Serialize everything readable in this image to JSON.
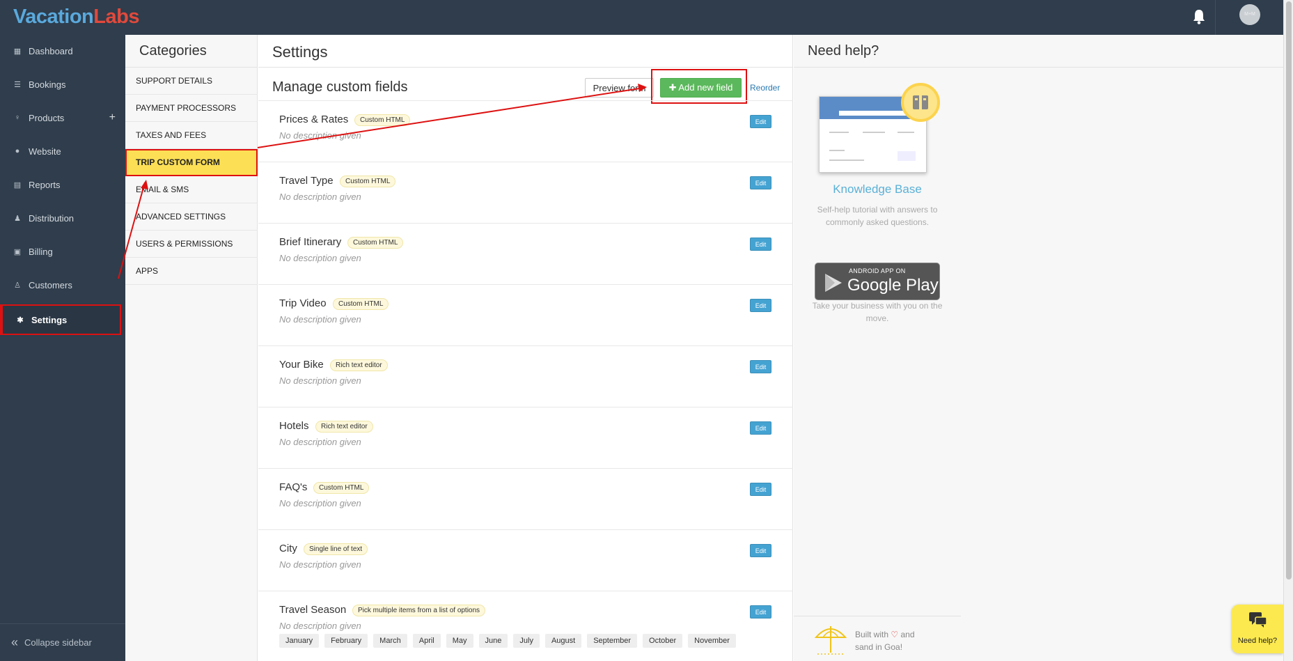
{
  "app": {
    "logo_part1": "Vacation",
    "logo_part2": "Labs",
    "avatar_text": "M+M"
  },
  "sidebar": {
    "items": [
      {
        "label": "Dashboard",
        "icon": "calendar-icon"
      },
      {
        "label": "Bookings",
        "icon": "list-icon"
      },
      {
        "label": "Products",
        "icon": "pin-icon",
        "action": "+"
      },
      {
        "label": "Website",
        "icon": "globe-icon"
      },
      {
        "label": "Reports",
        "icon": "report-icon"
      },
      {
        "label": "Distribution",
        "icon": "users-icon"
      },
      {
        "label": "Billing",
        "icon": "money-icon"
      },
      {
        "label": "Customers",
        "icon": "user-icon"
      },
      {
        "label": "Settings",
        "icon": "gear-icon",
        "active": true
      }
    ],
    "collapse_label": "Collapse sidebar"
  },
  "categories": {
    "title": "Categories",
    "items": [
      "SUPPORT DETAILS",
      "PAYMENT PROCESSORS",
      "TAXES AND FEES",
      "TRIP CUSTOM FORM",
      "EMAIL & SMS",
      "ADVANCED SETTINGS",
      "USERS & PERMISSIONS",
      "APPS"
    ],
    "active": "TRIP CUSTOM FORM"
  },
  "settings": {
    "title": "Settings",
    "subtitle": "Manage custom fields",
    "preview_label": "Preview form",
    "add_label": "Add new field",
    "reorder_label": "Reorder",
    "edit_label": "Edit",
    "fields": [
      {
        "name": "Prices & Rates",
        "type": "Custom HTML",
        "desc": "No description given"
      },
      {
        "name": "Travel Type",
        "type": "Custom HTML",
        "desc": "No description given"
      },
      {
        "name": "Brief Itinerary",
        "type": "Custom HTML",
        "desc": "No description given"
      },
      {
        "name": "Trip Video",
        "type": "Custom HTML",
        "desc": "No description given"
      },
      {
        "name": "Your Bike",
        "type": "Rich text editor",
        "desc": "No description given"
      },
      {
        "name": "Hotels",
        "type": "Rich text editor",
        "desc": "No description given"
      },
      {
        "name": "FAQ's",
        "type": "Custom HTML",
        "desc": "No description given"
      },
      {
        "name": "City",
        "type": "Single line of text",
        "desc": "No description given"
      },
      {
        "name": "Travel Season",
        "type": "Pick multiple items from a list of options",
        "desc": "No description given",
        "options": [
          "January",
          "February",
          "March",
          "April",
          "May",
          "June",
          "July",
          "August",
          "September",
          "October",
          "November"
        ]
      }
    ]
  },
  "help": {
    "title": "Need help?",
    "kb_title": "Knowledge Base",
    "kb_desc": "Self-help tutorial with answers to commonly asked questions.",
    "gplay_small": "ANDROID APP ON",
    "gplay_big": "Google Play",
    "gplay_desc": "Take your business with you on the move.",
    "built_line1": "Built with",
    "built_line1_end": "and",
    "built_line2": "sand in Goa!",
    "widget_label": "Need help?"
  },
  "colors": {
    "sidebar_bg": "#2f3d4c",
    "accent_green": "#5cb85c",
    "edit_blue": "#45a3d2",
    "active_yellow": "#fcdf55",
    "annotation_red": "#dd1111"
  }
}
